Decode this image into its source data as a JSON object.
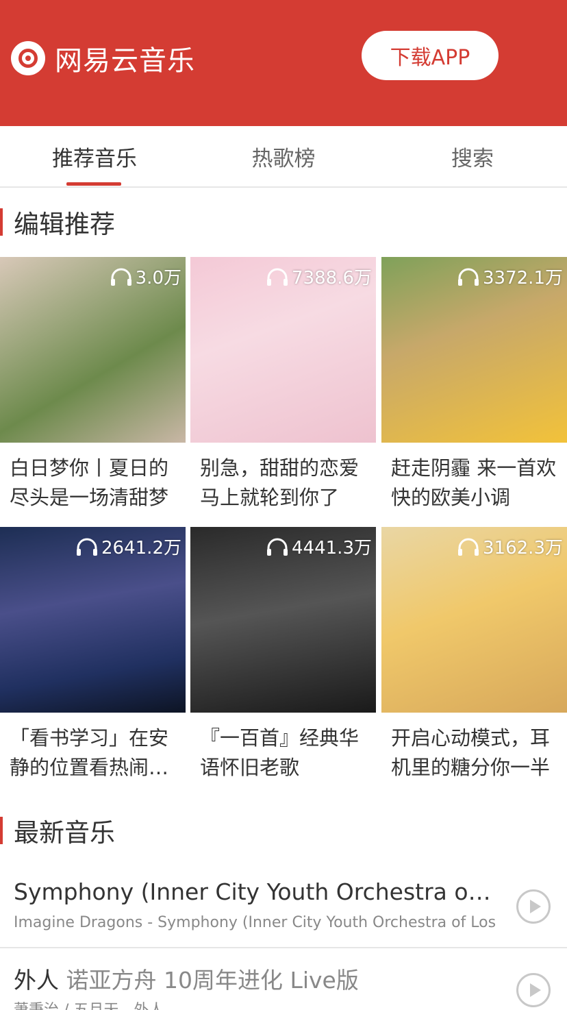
{
  "header": {
    "app_name": "网易云音乐",
    "download_label": "下载APP"
  },
  "tabs": [
    {
      "label": "推荐音乐",
      "active": true
    },
    {
      "label": "热歌榜",
      "active": false
    },
    {
      "label": "搜索",
      "active": false
    }
  ],
  "recommend": {
    "title": "编辑推荐",
    "playlists": [
      {
        "play_count": "3.0万",
        "title": "白日梦你丨夏日的尽头是一场清甜梦"
      },
      {
        "play_count": "7388.6万",
        "title": "别急，甜甜的恋爱马上就轮到你了"
      },
      {
        "play_count": "3372.1万",
        "title": "赶走阴霾 来一首欢快的欧美小调"
      },
      {
        "play_count": "2641.2万",
        "title": "「看书学习」在安静的位置看热闹的世界"
      },
      {
        "play_count": "4441.3万",
        "title": "『一百首』经典华语怀旧老歌"
      },
      {
        "play_count": "3162.3万",
        "title": "开启心动模式，耳机里的糖分你一半"
      }
    ]
  },
  "latest": {
    "title": "最新音乐",
    "songs": [
      {
        "name": "Symphony (Inner City Youth Orchestra of Los Angeles Remix)",
        "extra": "",
        "sub": "Imagine Dragons - Symphony (Inner City Youth Orchestra of Los Angeles Remix)"
      },
      {
        "name": "外人",
        "extra": " 诺亚方舟 10周年进化 Live版",
        "sub": "萧秉治 / 五月天 - 外人"
      }
    ]
  },
  "colors": {
    "brand_red": "#d43c33"
  }
}
